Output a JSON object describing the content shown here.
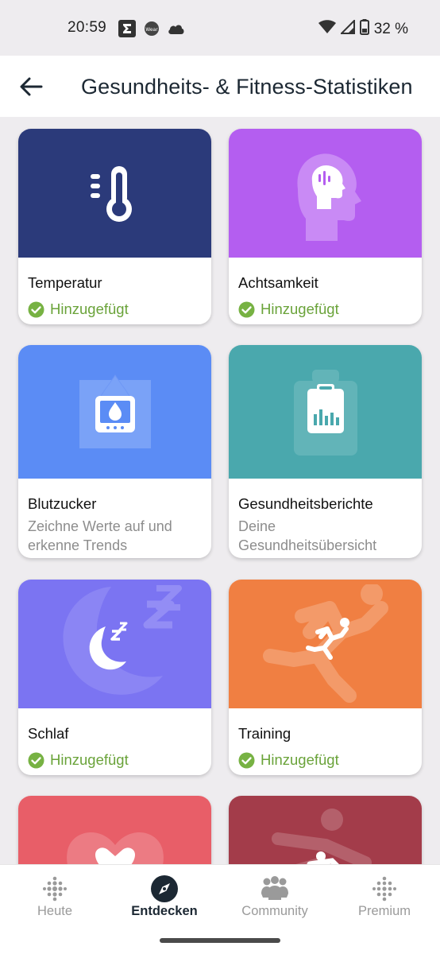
{
  "status_bar": {
    "time": "20:59",
    "battery": "32 %",
    "icons": [
      "sigma-icon",
      "app-badge-icon",
      "cloud-icon",
      "wifi-icon",
      "cell-signal-icon",
      "battery-icon"
    ]
  },
  "app_bar": {
    "back_icon": "arrow-left-icon",
    "title": "Gesundheits- & Fitness-Statistiken"
  },
  "cards": [
    {
      "title": "Temperatur",
      "status": "Hinzugefügt",
      "color": "#2b3a7a",
      "icon": "thermometer-icon"
    },
    {
      "title": "Achtsamkeit",
      "status": "Hinzugefügt",
      "color": "#b45ef0",
      "icon": "mind-head-icon"
    },
    {
      "title": "Blutzucker",
      "description": "Zeichne Werte auf und erkenne Trends",
      "color": "#5b8cf5",
      "icon": "blood-drop-meter-icon"
    },
    {
      "title": "Gesundheitsberichte",
      "description": "Deine Gesundheitsübersicht",
      "color": "#4aa8ad",
      "icon": "clipboard-chart-icon"
    },
    {
      "title": "Schlaf",
      "status": "Hinzugefügt",
      "color": "#7b74f2",
      "icon": "moon-zz-icon"
    },
    {
      "title": "Training",
      "status": "Hinzugefügt",
      "color": "#f07f42",
      "icon": "running-person-icon"
    },
    {
      "color": "#e85e68",
      "icon": "heart-rate-icon"
    },
    {
      "color": "#a33c4a",
      "icon": "athlete-icon"
    }
  ],
  "colors": {
    "status_green": "#6aa33a",
    "check_green": "#77b243"
  },
  "bottom_nav": [
    {
      "label": "Heute",
      "icon": "dots-grid-icon",
      "active": false
    },
    {
      "label": "Entdecken",
      "icon": "compass-icon",
      "active": true
    },
    {
      "label": "Community",
      "icon": "people-icon",
      "active": false
    },
    {
      "label": "Premium",
      "icon": "dots-diamond-icon",
      "active": false
    }
  ]
}
